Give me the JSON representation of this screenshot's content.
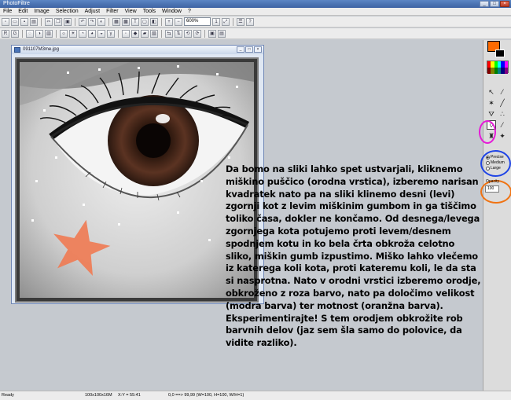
{
  "window": {
    "title": "PhotoFiltre"
  },
  "menu": [
    "File",
    "Edit",
    "Image",
    "Selection",
    "Adjust",
    "Filter",
    "View",
    "Tools",
    "Window",
    "?"
  ],
  "toolbar": {
    "zoom_value": "600%"
  },
  "image_window": {
    "title": "091107M3me.jpg"
  },
  "tool_options": {
    "mode_options": [
      "Precise",
      "Medium",
      "Large"
    ],
    "selected_mode": "Precise",
    "opacity_label": "Opacity",
    "opacity_value": "100"
  },
  "colors": {
    "foreground": "#ff6a00",
    "background": "#000000",
    "highlight_magenta": "#e61ad8",
    "highlight_blue": "#1f44e6",
    "highlight_orange": "#f07312"
  },
  "tools": [
    "select-arrow",
    "eyedropper",
    "magic-wand",
    "line",
    "fill-bucket",
    "spray",
    "blur-drop",
    "brush",
    "clone-stamp",
    "dodge",
    "smudge",
    "shapes"
  ],
  "tutorial_text": "Da bomo na sliki lahko spet ustvarjali, kliknemo miškino puščico (orodna vrstica), izberemo narisan kvadratek nato pa na sliki klinemo desni (levi) zgornji kot z levim miškinim gumbom in ga tiščimo toliko časa, dokler ne končamo. Od desnega/levega zgornjega kota potujemo proti levem/desnem spodnjem kotu in ko bela črta obkroža celotno sliko, miškin gumb izpustimo. Miško lahko vlečemo iz katerega koli kota, proti kateremu koli, le da sta si nasprotna. Nato v orodni vrstici izberemo orodje, obkroženo z roza barvo, nato pa določimo velikost (modra barva) ter motnost (oranžna barva). Eksperimentirajte! S tem orodjem obkrožite rob barvnih delov (jaz sem šla samo do polovice, da vidite razliko).",
  "status": {
    "state": "Ready",
    "size": "100x100x16M",
    "coords": "X:Y = 55:41",
    "selection": "0,0 ==> 99,99 (W=100, H=100, W/H=1)"
  }
}
